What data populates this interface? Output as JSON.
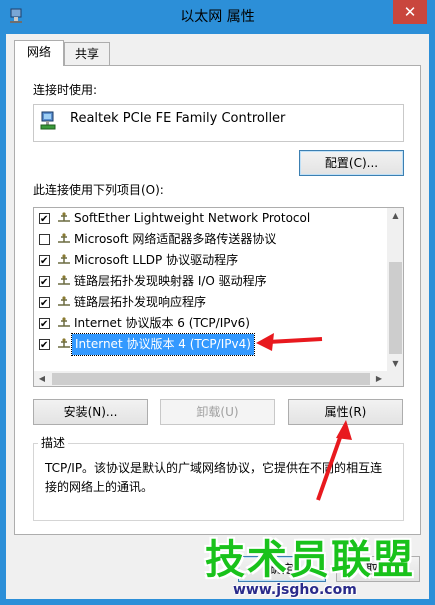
{
  "window": {
    "title": "以太网 属性",
    "close_glyph": "✕"
  },
  "tabs": [
    {
      "label": "网络"
    },
    {
      "label": "共享"
    }
  ],
  "connect_using": {
    "label": "连接时使用:",
    "adapter": "Realtek PCIe FE Family Controller"
  },
  "configure_button": "配置(C)...",
  "items_label": "此连接使用下列项目(O):",
  "items": [
    {
      "label": "SoftEther Lightweight Network Protocol",
      "checked": true
    },
    {
      "label": "Microsoft 网络适配器多路传送器协议",
      "checked": false
    },
    {
      "label": "Microsoft LLDP 协议驱动程序",
      "checked": true
    },
    {
      "label": "链路层拓扑发现映射器 I/O 驱动程序",
      "checked": true
    },
    {
      "label": "链路层拓扑发现响应程序",
      "checked": true
    },
    {
      "label": "Internet 协议版本 6 (TCP/IPv6)",
      "checked": true
    },
    {
      "label": "Internet 协议版本 4 (TCP/IPv4)",
      "checked": true,
      "selected": true
    }
  ],
  "buttons": {
    "install": "安装(N)...",
    "uninstall": "卸载(U)",
    "properties": "属性(R)",
    "ok": "确定",
    "cancel": "取消"
  },
  "description": {
    "legend": "描述",
    "text_line1": "TCP/IP。该协议是默认的广域网络协议，它提供在不同的相互连",
    "text_line2": "接的网络上的通讯。"
  },
  "watermark": {
    "title": "技术员联盟",
    "url": "www.jsgho.com"
  },
  "colors": {
    "title_bar": "#2c8fd8",
    "selection": "#3399ff",
    "arrow": "#e8191e",
    "watermark_green": "#19c21b"
  },
  "icons": {
    "adapter": "network-adapter-icon",
    "protocol": "network-protocol-icon"
  }
}
